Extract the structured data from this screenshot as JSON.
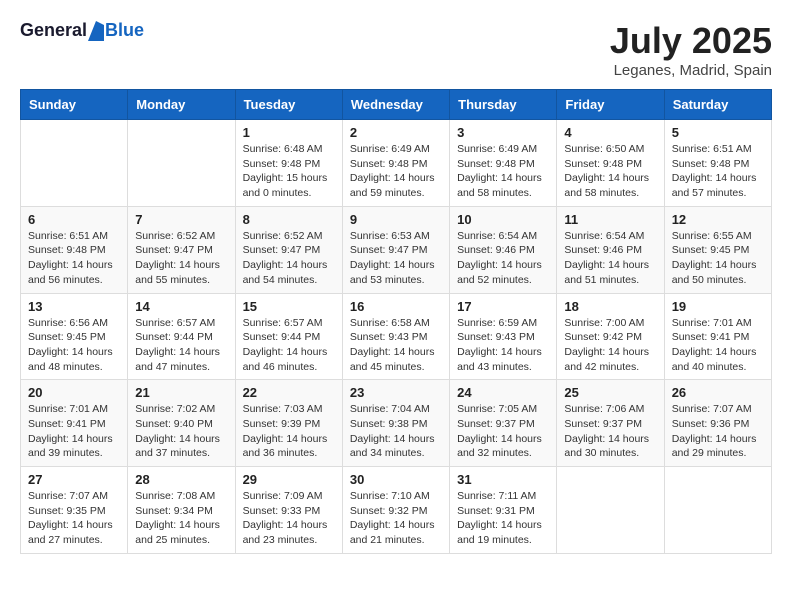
{
  "header": {
    "logo_general": "General",
    "logo_blue": "Blue",
    "month_title": "July 2025",
    "location": "Leganes, Madrid, Spain"
  },
  "days_of_week": [
    "Sunday",
    "Monday",
    "Tuesday",
    "Wednesday",
    "Thursday",
    "Friday",
    "Saturday"
  ],
  "weeks": [
    [
      {
        "day": "",
        "content": ""
      },
      {
        "day": "",
        "content": ""
      },
      {
        "day": "1",
        "content": "Sunrise: 6:48 AM\nSunset: 9:48 PM\nDaylight: 15 hours and 0 minutes."
      },
      {
        "day": "2",
        "content": "Sunrise: 6:49 AM\nSunset: 9:48 PM\nDaylight: 14 hours and 59 minutes."
      },
      {
        "day": "3",
        "content": "Sunrise: 6:49 AM\nSunset: 9:48 PM\nDaylight: 14 hours and 58 minutes."
      },
      {
        "day": "4",
        "content": "Sunrise: 6:50 AM\nSunset: 9:48 PM\nDaylight: 14 hours and 58 minutes."
      },
      {
        "day": "5",
        "content": "Sunrise: 6:51 AM\nSunset: 9:48 PM\nDaylight: 14 hours and 57 minutes."
      }
    ],
    [
      {
        "day": "6",
        "content": "Sunrise: 6:51 AM\nSunset: 9:48 PM\nDaylight: 14 hours and 56 minutes."
      },
      {
        "day": "7",
        "content": "Sunrise: 6:52 AM\nSunset: 9:47 PM\nDaylight: 14 hours and 55 minutes."
      },
      {
        "day": "8",
        "content": "Sunrise: 6:52 AM\nSunset: 9:47 PM\nDaylight: 14 hours and 54 minutes."
      },
      {
        "day": "9",
        "content": "Sunrise: 6:53 AM\nSunset: 9:47 PM\nDaylight: 14 hours and 53 minutes."
      },
      {
        "day": "10",
        "content": "Sunrise: 6:54 AM\nSunset: 9:46 PM\nDaylight: 14 hours and 52 minutes."
      },
      {
        "day": "11",
        "content": "Sunrise: 6:54 AM\nSunset: 9:46 PM\nDaylight: 14 hours and 51 minutes."
      },
      {
        "day": "12",
        "content": "Sunrise: 6:55 AM\nSunset: 9:45 PM\nDaylight: 14 hours and 50 minutes."
      }
    ],
    [
      {
        "day": "13",
        "content": "Sunrise: 6:56 AM\nSunset: 9:45 PM\nDaylight: 14 hours and 48 minutes."
      },
      {
        "day": "14",
        "content": "Sunrise: 6:57 AM\nSunset: 9:44 PM\nDaylight: 14 hours and 47 minutes."
      },
      {
        "day": "15",
        "content": "Sunrise: 6:57 AM\nSunset: 9:44 PM\nDaylight: 14 hours and 46 minutes."
      },
      {
        "day": "16",
        "content": "Sunrise: 6:58 AM\nSunset: 9:43 PM\nDaylight: 14 hours and 45 minutes."
      },
      {
        "day": "17",
        "content": "Sunrise: 6:59 AM\nSunset: 9:43 PM\nDaylight: 14 hours and 43 minutes."
      },
      {
        "day": "18",
        "content": "Sunrise: 7:00 AM\nSunset: 9:42 PM\nDaylight: 14 hours and 42 minutes."
      },
      {
        "day": "19",
        "content": "Sunrise: 7:01 AM\nSunset: 9:41 PM\nDaylight: 14 hours and 40 minutes."
      }
    ],
    [
      {
        "day": "20",
        "content": "Sunrise: 7:01 AM\nSunset: 9:41 PM\nDaylight: 14 hours and 39 minutes."
      },
      {
        "day": "21",
        "content": "Sunrise: 7:02 AM\nSunset: 9:40 PM\nDaylight: 14 hours and 37 minutes."
      },
      {
        "day": "22",
        "content": "Sunrise: 7:03 AM\nSunset: 9:39 PM\nDaylight: 14 hours and 36 minutes."
      },
      {
        "day": "23",
        "content": "Sunrise: 7:04 AM\nSunset: 9:38 PM\nDaylight: 14 hours and 34 minutes."
      },
      {
        "day": "24",
        "content": "Sunrise: 7:05 AM\nSunset: 9:37 PM\nDaylight: 14 hours and 32 minutes."
      },
      {
        "day": "25",
        "content": "Sunrise: 7:06 AM\nSunset: 9:37 PM\nDaylight: 14 hours and 30 minutes."
      },
      {
        "day": "26",
        "content": "Sunrise: 7:07 AM\nSunset: 9:36 PM\nDaylight: 14 hours and 29 minutes."
      }
    ],
    [
      {
        "day": "27",
        "content": "Sunrise: 7:07 AM\nSunset: 9:35 PM\nDaylight: 14 hours and 27 minutes."
      },
      {
        "day": "28",
        "content": "Sunrise: 7:08 AM\nSunset: 9:34 PM\nDaylight: 14 hours and 25 minutes."
      },
      {
        "day": "29",
        "content": "Sunrise: 7:09 AM\nSunset: 9:33 PM\nDaylight: 14 hours and 23 minutes."
      },
      {
        "day": "30",
        "content": "Sunrise: 7:10 AM\nSunset: 9:32 PM\nDaylight: 14 hours and 21 minutes."
      },
      {
        "day": "31",
        "content": "Sunrise: 7:11 AM\nSunset: 9:31 PM\nDaylight: 14 hours and 19 minutes."
      },
      {
        "day": "",
        "content": ""
      },
      {
        "day": "",
        "content": ""
      }
    ]
  ]
}
